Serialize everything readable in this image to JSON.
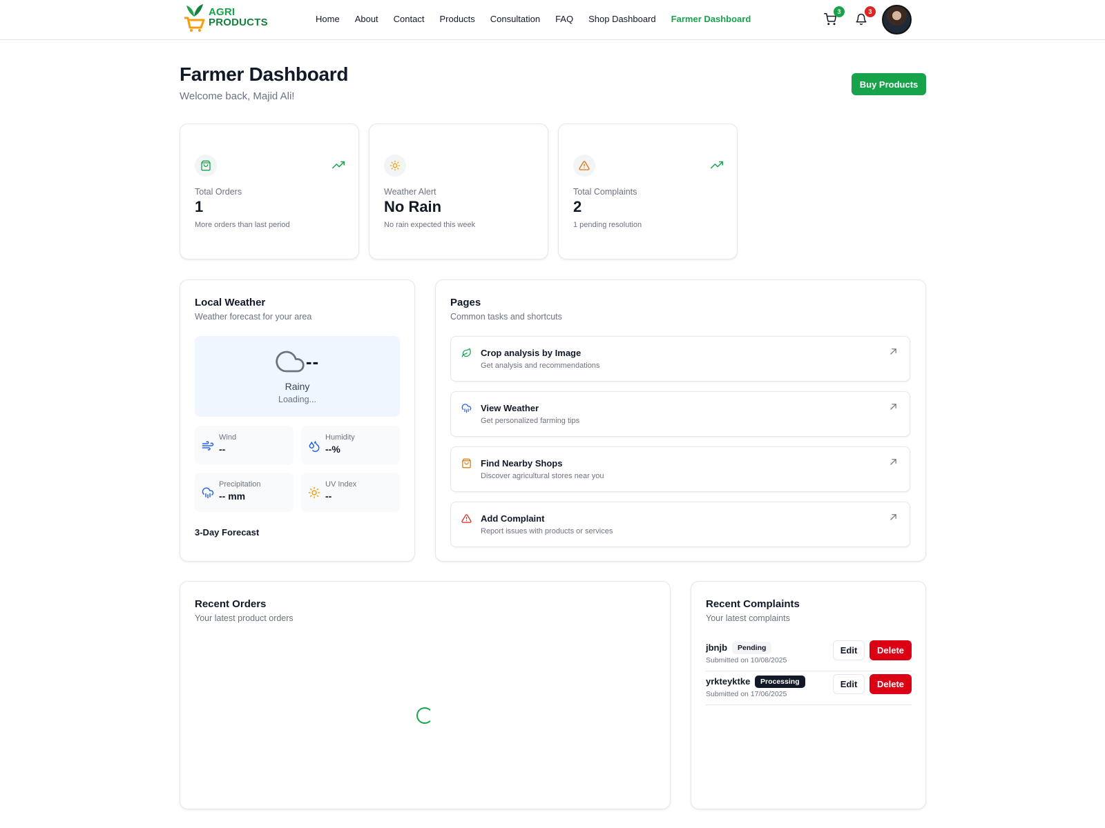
{
  "brand": {
    "line1": "AGRI",
    "line2": "PRODUCTS"
  },
  "nav": {
    "links": [
      "Home",
      "About",
      "Contact",
      "Products",
      "Consultation",
      "FAQ",
      "Shop Dashboard",
      "Farmer Dashboard"
    ],
    "active": "Farmer Dashboard",
    "cart_count": "3",
    "notification_count": "3"
  },
  "header": {
    "title": "Farmer Dashboard",
    "subtitle": "Welcome back, Majid Ali!",
    "buy_button": "Buy Products"
  },
  "stats": [
    {
      "icon": "shopping-bag-icon",
      "label": "Total Orders",
      "value": "1",
      "note": "More orders than last period",
      "trend": true
    },
    {
      "icon": "sun-icon",
      "label": "Weather Alert",
      "value": "No Rain",
      "note": "No rain expected this week",
      "trend": false
    },
    {
      "icon": "alert-triangle-icon",
      "label": "Total Complaints",
      "value": "2",
      "note": "1 pending resolution",
      "trend": true
    }
  ],
  "weather": {
    "title": "Local Weather",
    "subtitle": "Weather forecast for your area",
    "temperature": "--",
    "condition": "Rainy",
    "status": "Loading...",
    "metrics": [
      {
        "icon": "wind-icon",
        "label": "Wind",
        "value": "--"
      },
      {
        "icon": "droplets-icon",
        "label": "Humidity",
        "value": "--%"
      },
      {
        "icon": "cloud-rain-icon",
        "label": "Precipitation",
        "value": "-- mm"
      },
      {
        "icon": "sun-icon",
        "label": "UV Index",
        "value": "--"
      }
    ],
    "forecast_title": "3-Day Forecast"
  },
  "pages": {
    "title": "Pages",
    "subtitle": "Common tasks and shortcuts",
    "items": [
      {
        "icon": "leaf-icon",
        "title": "Crop analysis by Image",
        "desc": "Get analysis and recommendations"
      },
      {
        "icon": "cloud-rain-icon",
        "title": "View Weather",
        "desc": "Get personalized farming tips"
      },
      {
        "icon": "shopping-bag-icon",
        "title": "Find Nearby Shops",
        "desc": "Discover agricultural stores near you"
      },
      {
        "icon": "alert-triangle-icon",
        "title": "Add Complaint",
        "desc": "Report issues with products or services"
      }
    ]
  },
  "orders": {
    "title": "Recent Orders",
    "subtitle": "Your latest product orders"
  },
  "complaints": {
    "title": "Recent Complaints",
    "subtitle": "Your latest complaints",
    "edit_label": "Edit",
    "delete_label": "Delete",
    "items": [
      {
        "name": "jbnjb",
        "status": "Pending",
        "date": "Submitted on 10/08/2025"
      },
      {
        "name": "yrkteyktke",
        "status": "Processing",
        "date": "Submitted on 17/06/2025"
      }
    ]
  },
  "colors": {
    "primary": "#16a34a",
    "danger": "#dc0014",
    "weather_bg": "#eff6ff"
  }
}
